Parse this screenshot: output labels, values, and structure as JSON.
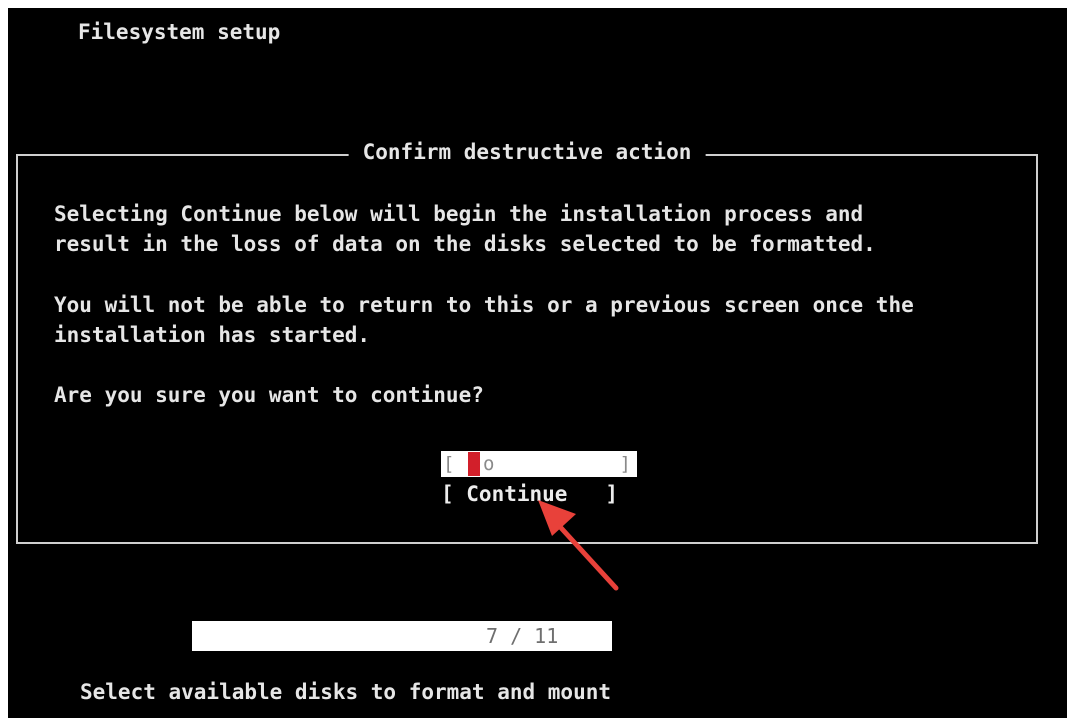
{
  "header": {
    "title": "Filesystem setup"
  },
  "dialog": {
    "title": "Confirm destructive action",
    "lines": [
      "Selecting Continue below will begin the installation process and",
      "result in the loss of data on the disks selected to be formatted.",
      "You will not be able to return to this or a previous screen once the",
      "installation has started.",
      "Are you sure you want to continue?"
    ],
    "confirm_field": {
      "left_bracket": "[",
      "value": "o",
      "right_bracket": "]"
    },
    "continue_button": "[ Continue   ]"
  },
  "progress": {
    "text": "7 / 11",
    "fraction": 0.636
  },
  "footer": {
    "hint": "Select available disks to format and mount"
  },
  "colors": {
    "background": "#000000",
    "text": "#e6e6e6",
    "cursor": "#d21f2a",
    "annotation_arrow": "#e8413a"
  }
}
